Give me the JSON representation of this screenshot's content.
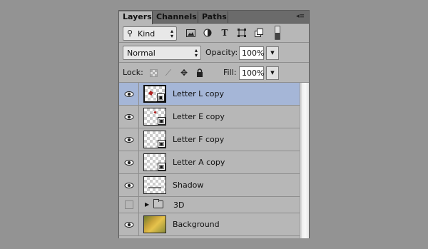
{
  "tabs": [
    {
      "label": "Layers",
      "active": true
    },
    {
      "label": "Channels",
      "active": false
    },
    {
      "label": "Paths",
      "active": false
    }
  ],
  "filter": {
    "kind_label": "Kind",
    "icons": [
      "image-filter-icon",
      "adjustment-filter-icon",
      "type-filter-icon",
      "shape-filter-icon",
      "smart-object-filter-icon"
    ]
  },
  "blend": {
    "mode": "Normal",
    "opacity_label": "Opacity:",
    "opacity_value": "100%"
  },
  "lock": {
    "label": "Lock:",
    "fill_label": "Fill:",
    "fill_value": "100%"
  },
  "layers": [
    {
      "name": "Letter L copy",
      "visible": true,
      "selected": true
    },
    {
      "name": "Letter E copy",
      "visible": true
    },
    {
      "name": "Letter F copy",
      "visible": true
    },
    {
      "name": "Letter A copy",
      "visible": true
    },
    {
      "name": "Shadow",
      "visible": true
    },
    {
      "name": "3D",
      "visible": false,
      "group": true
    },
    {
      "name": "Background",
      "visible": true
    }
  ],
  "colors": {
    "panel": "#b7b7b7",
    "selected_row": "#a5b6d7",
    "background": "#939393"
  }
}
